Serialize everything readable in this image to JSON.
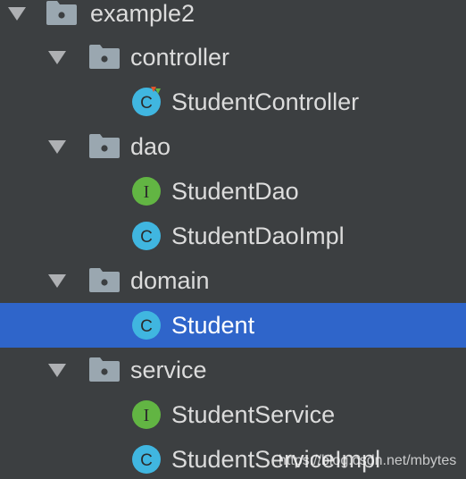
{
  "colors": {
    "background": "#3c3f41",
    "selection": "#2f65ca",
    "text": "#dcdcdc",
    "folder": "#9aa7b0",
    "class_icon": "#40b6e0",
    "interface_icon": "#62b543"
  },
  "tree": [
    {
      "label": "example2",
      "type": "package",
      "expanded": true,
      "level": 0,
      "icon": "package-folder-icon"
    },
    {
      "label": "controller",
      "type": "package",
      "expanded": true,
      "level": 1,
      "icon": "package-folder-icon"
    },
    {
      "label": "StudentController",
      "type": "class",
      "level": 2,
      "icon": "spring-class-icon",
      "icon_letter": "C"
    },
    {
      "label": "dao",
      "type": "package",
      "expanded": true,
      "level": 1,
      "icon": "package-folder-icon"
    },
    {
      "label": "StudentDao",
      "type": "interface",
      "level": 2,
      "icon": "interface-icon",
      "icon_letter": "I"
    },
    {
      "label": "StudentDaoImpl",
      "type": "class",
      "level": 2,
      "icon": "class-icon",
      "icon_letter": "C"
    },
    {
      "label": "domain",
      "type": "package",
      "expanded": true,
      "level": 1,
      "icon": "package-folder-icon"
    },
    {
      "label": "Student",
      "type": "class",
      "level": 2,
      "icon": "class-icon",
      "icon_letter": "C",
      "selected": true
    },
    {
      "label": "service",
      "type": "package",
      "expanded": true,
      "level": 1,
      "icon": "package-folder-icon"
    },
    {
      "label": "StudentService",
      "type": "interface",
      "level": 2,
      "icon": "interface-icon",
      "icon_letter": "I"
    },
    {
      "label": "StudentServiceImpl",
      "type": "class",
      "level": 2,
      "icon": "class-icon",
      "icon_letter": "C"
    }
  ],
  "watermark": "https://blog.csdn.net/mbytes"
}
